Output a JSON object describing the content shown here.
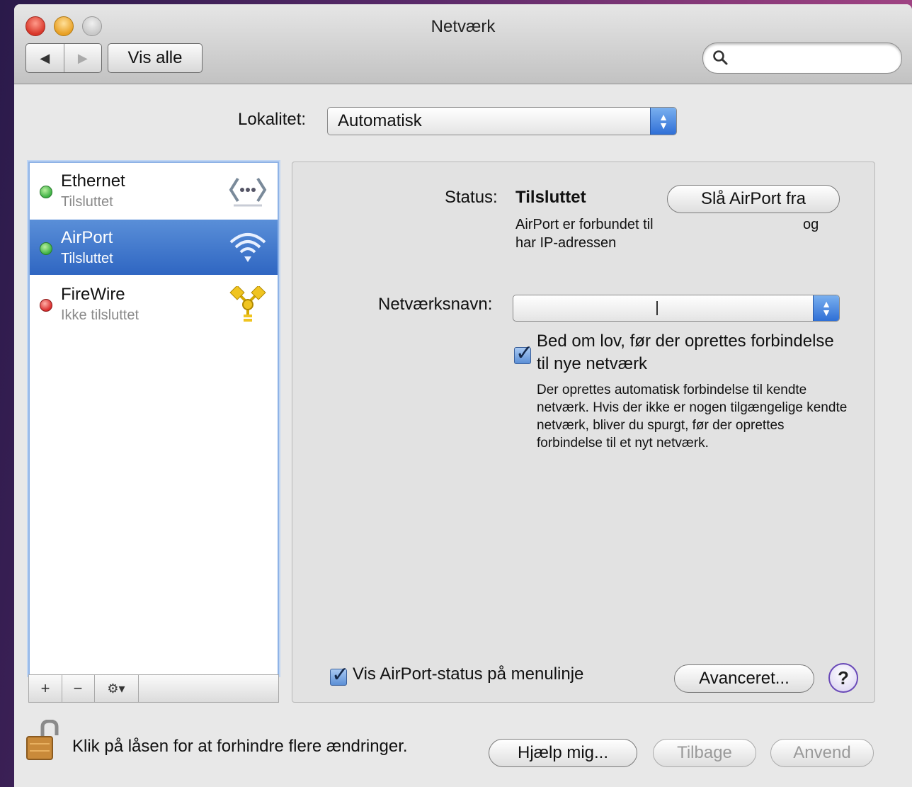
{
  "window": {
    "title": "Netværk"
  },
  "toolbar": {
    "back_glyph": "◀",
    "forward_glyph": "▶",
    "show_all_label": "Vis alle",
    "search_placeholder": ""
  },
  "location": {
    "label": "Lokalitet:",
    "value": "Automatisk"
  },
  "services": [
    {
      "name": "Ethernet",
      "status": "Tilsluttet",
      "status_color": "#3cb043",
      "icon": "ethernet-icon"
    },
    {
      "name": "AirPort",
      "status": "Tilsluttet",
      "status_color": "#3cb043",
      "icon": "wifi-icon",
      "selected": true
    },
    {
      "name": "FireWire",
      "status": "Ikke tilsluttet",
      "status_color": "#d92b2b",
      "icon": "firewire-icon"
    }
  ],
  "sidebar_tools": {
    "add": "+",
    "remove": "−",
    "gear": "⚙▾"
  },
  "detail": {
    "status_label": "Status:",
    "status_value": "Tilsluttet",
    "toggle_button": "Slå AirPort fra",
    "info_line1": "AirPort er forbundet til",
    "info_og": "og",
    "info_line2": "har IP-adressen",
    "network_name_label": "Netværksnavn:",
    "network_name_value": "",
    "ask_to_join_label": "Bed om lov, før der oprettes forbindelse til nye netværk",
    "ask_to_join_checked": true,
    "ask_to_join_desc": "Der oprettes automatisk forbindelse til kendte netværk. Hvis der ikke er nogen tilgængelige kendte netværk, bliver du spurgt, før der oprettes forbindelse til et nyt netværk.",
    "show_status_label": "Vis AirPort-status på menulinje",
    "show_status_checked": true,
    "advanced_button": "Avanceret...",
    "help_glyph": "?"
  },
  "footer": {
    "lock_text": "Klik på låsen for at forhindre flere ændringer.",
    "assist_button": "Hjælp mig...",
    "revert_button": "Tilbage",
    "apply_button": "Anvend"
  },
  "colors": {
    "selection": "#2f66c2",
    "accent": "#3a7be0"
  }
}
